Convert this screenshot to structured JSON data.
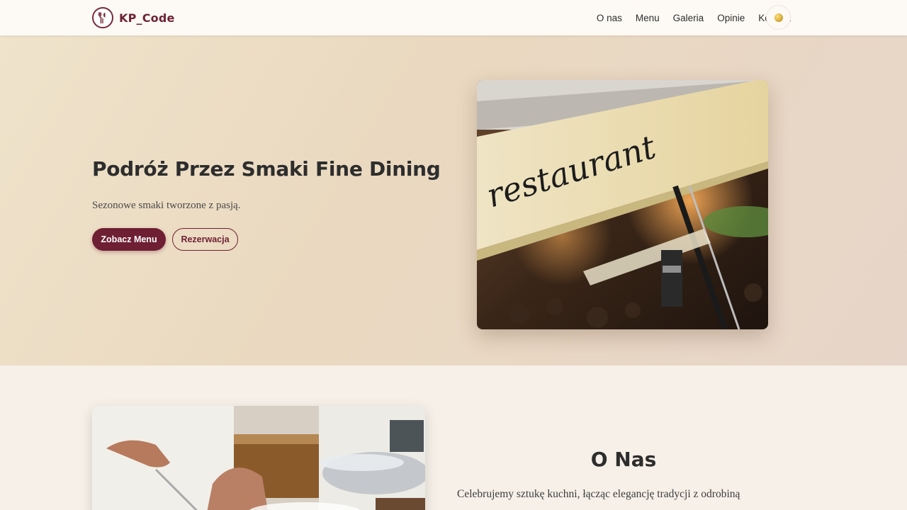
{
  "header": {
    "brand": "KP_Code",
    "nav": [
      "O nas",
      "Menu",
      "Galeria",
      "Opinie",
      "Kontact"
    ]
  },
  "hero": {
    "title": "Podróż Przez Smaki Fine Dining",
    "subtitle": "Sezonowe smaki tworzone z pasją.",
    "primary_button": "Zobacz Menu",
    "secondary_button": "Rezerwacja",
    "image_sign_text": "restaurant"
  },
  "about": {
    "title": "O Nas",
    "text": "Celebrujemy sztukę kuchni, łącząc elegancję tradycji z odrobiną"
  },
  "colors": {
    "accent": "#6e1f33",
    "header_bg": "#fdfaf5",
    "hero_bg": "#ecdcc4",
    "page_bg": "#f6f0e8"
  },
  "icons": {
    "logo": "fork-knife-icon",
    "theme_toggle": "theme-toggle-icon"
  }
}
